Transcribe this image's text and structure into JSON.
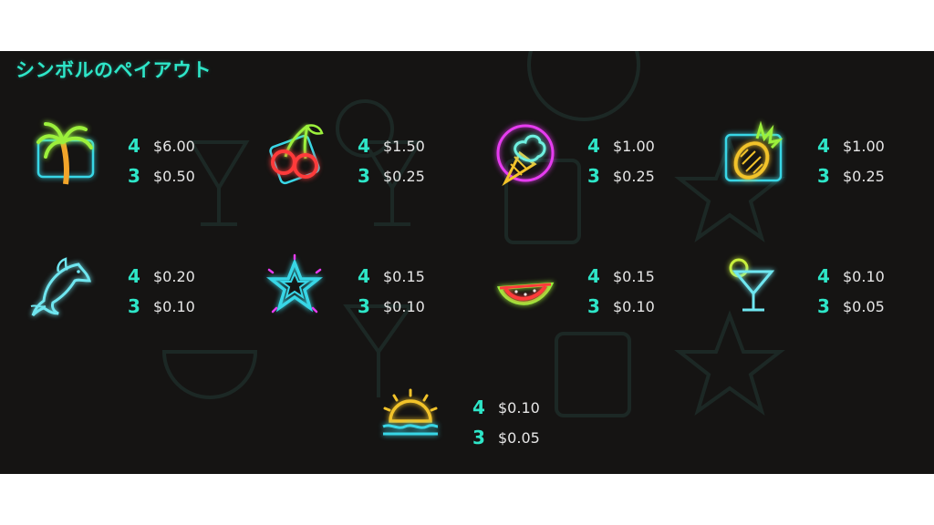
{
  "title": "シンボルのペイアウト",
  "colors": {
    "accent": "#2ee6c8",
    "panel_bg": "#151413",
    "amount_text": "#e6e6e6"
  },
  "symbols": [
    {
      "icon": "palm-tree-icon",
      "payouts": [
        {
          "count": "4",
          "amount": "$6.00"
        },
        {
          "count": "3",
          "amount": "$0.50"
        }
      ]
    },
    {
      "icon": "cherries-icon",
      "payouts": [
        {
          "count": "4",
          "amount": "$1.50"
        },
        {
          "count": "3",
          "amount": "$0.25"
        }
      ]
    },
    {
      "icon": "ice-cream-icon",
      "payouts": [
        {
          "count": "4",
          "amount": "$1.00"
        },
        {
          "count": "3",
          "amount": "$0.25"
        }
      ]
    },
    {
      "icon": "pineapple-icon",
      "payouts": [
        {
          "count": "4",
          "amount": "$1.00"
        },
        {
          "count": "3",
          "amount": "$0.25"
        }
      ]
    },
    {
      "icon": "dolphin-icon",
      "payouts": [
        {
          "count": "4",
          "amount": "$0.20"
        },
        {
          "count": "3",
          "amount": "$0.10"
        }
      ]
    },
    {
      "icon": "star-icon",
      "payouts": [
        {
          "count": "4",
          "amount": "$0.15"
        },
        {
          "count": "3",
          "amount": "$0.10"
        }
      ]
    },
    {
      "icon": "watermelon-icon",
      "payouts": [
        {
          "count": "4",
          "amount": "$0.15"
        },
        {
          "count": "3",
          "amount": "$0.10"
        }
      ]
    },
    {
      "icon": "cocktail-icon",
      "payouts": [
        {
          "count": "4",
          "amount": "$0.10"
        },
        {
          "count": "3",
          "amount": "$0.05"
        }
      ]
    },
    {
      "icon": "sunset-icon",
      "payouts": [
        {
          "count": "4",
          "amount": "$0.10"
        },
        {
          "count": "3",
          "amount": "$0.05"
        }
      ]
    }
  ]
}
